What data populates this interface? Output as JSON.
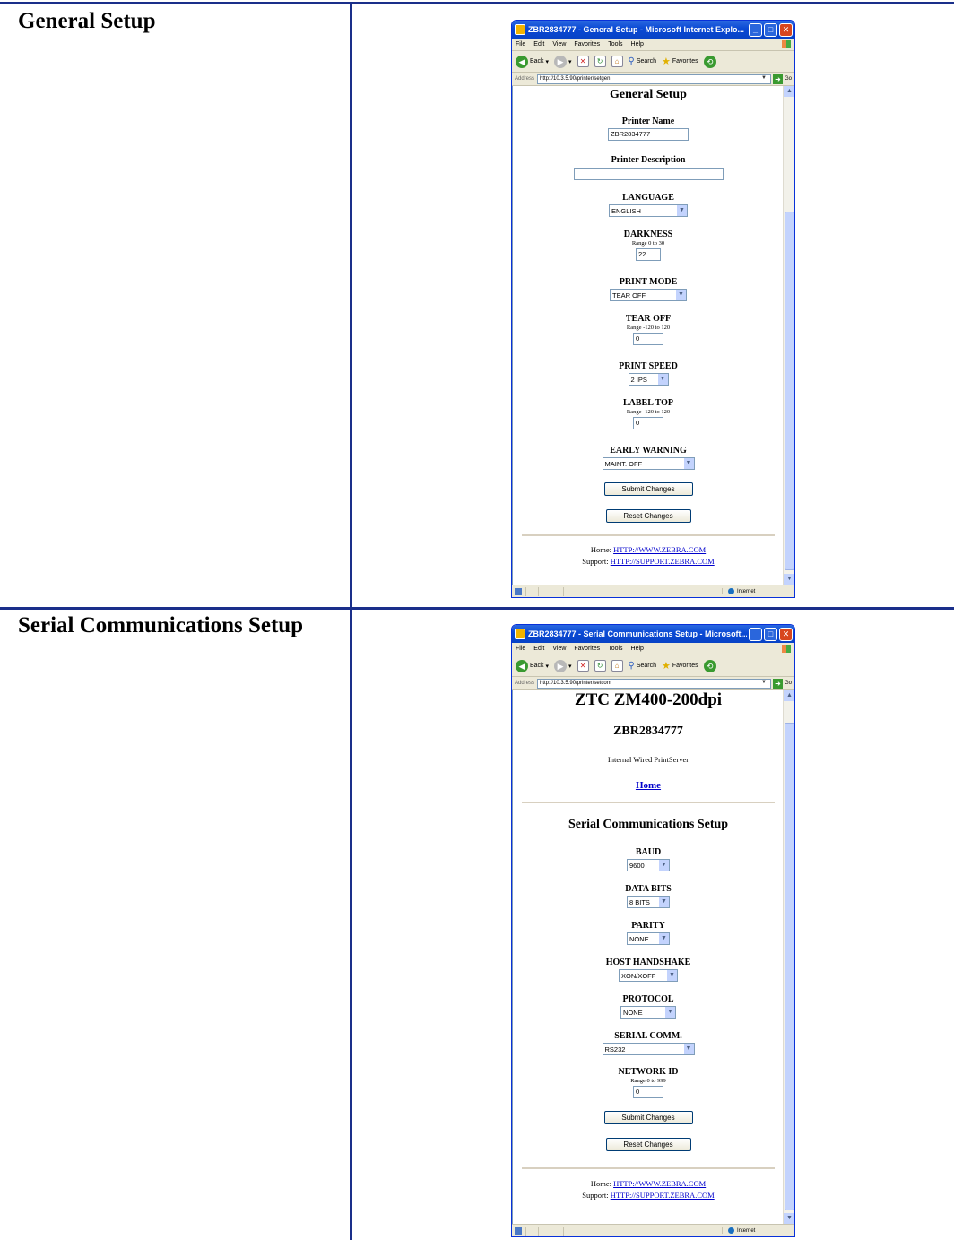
{
  "rows": [
    {
      "label": "General Setup",
      "window": {
        "title": "ZBR2834777 - General Setup - Microsoft Internet Explo...",
        "menu": [
          "File",
          "Edit",
          "View",
          "Favorites",
          "Tools",
          "Help"
        ],
        "toolbar": {
          "back": "Back",
          "search": "Search",
          "favorites": "Favorites"
        },
        "address_label": "Address",
        "url": "http://10.3.5.90/printer/setgen",
        "go": "Go",
        "status_zone": "Internet",
        "page": {
          "heading": "General Setup",
          "printer_name_label": "Printer Name",
          "printer_name_value": "ZBR2834777",
          "printer_desc_label": "Printer Description",
          "printer_desc_value": "",
          "language_label": "LANGUAGE",
          "language_value": "ENGLISH",
          "darkness_label": "DARKNESS",
          "darkness_range": "Range 0 to 30",
          "darkness_value": "22",
          "print_mode_label": "PRINT MODE",
          "print_mode_value": "TEAR OFF",
          "tear_off_label": "TEAR OFF",
          "tear_off_range": "Range -120 to 120",
          "tear_off_value": "0",
          "print_speed_label": "PRINT SPEED",
          "print_speed_value": "2 IPS",
          "label_top_label": "LABEL TOP",
          "label_top_range": "Range -120 to 120",
          "label_top_value": "0",
          "early_warning_label": "EARLY WARNING",
          "early_warning_value": "MAINT. OFF",
          "submit": "Submit Changes",
          "reset": "Reset Changes",
          "home_label": "Home:",
          "home_link": "HTTP://WWW.ZEBRA.COM",
          "support_label": "Support:",
          "support_link": "HTTP://SUPPORT.ZEBRA.COM"
        }
      }
    },
    {
      "label": "Serial Communications Setup",
      "window": {
        "title": "ZBR2834777 - Serial Communications Setup - Microsoft...",
        "menu": [
          "File",
          "Edit",
          "View",
          "Favorites",
          "Tools",
          "Help"
        ],
        "toolbar": {
          "back": "Back",
          "search": "Search",
          "favorites": "Favorites"
        },
        "address_label": "Address",
        "url": "http://10.3.5.90/printer/setcom",
        "go": "Go",
        "status_zone": "Internet",
        "page": {
          "model": "ZTC ZM400-200dpi",
          "printer_name": "ZBR2834777",
          "server": "Internal Wired PrintServer",
          "home_nav": "Home",
          "heading": "Serial Communications Setup",
          "baud_label": "BAUD",
          "baud_value": "9600",
          "data_bits_label": "DATA BITS",
          "data_bits_value": "8 BITS",
          "parity_label": "PARITY",
          "parity_value": "NONE",
          "handshake_label": "HOST HANDSHAKE",
          "handshake_value": "XON/XOFF",
          "protocol_label": "PROTOCOL",
          "protocol_value": "NONE",
          "serial_comm_label": "SERIAL COMM.",
          "serial_comm_value": "RS232",
          "network_id_label": "NETWORK ID",
          "network_id_range": "Range 0 to 999",
          "network_id_value": "0",
          "submit": "Submit Changes",
          "reset": "Reset Changes",
          "home_label": "Home:",
          "home_link": "HTTP://WWW.ZEBRA.COM",
          "support_label": "Support:",
          "support_link": "HTTP://SUPPORT.ZEBRA.COM"
        }
      }
    }
  ]
}
